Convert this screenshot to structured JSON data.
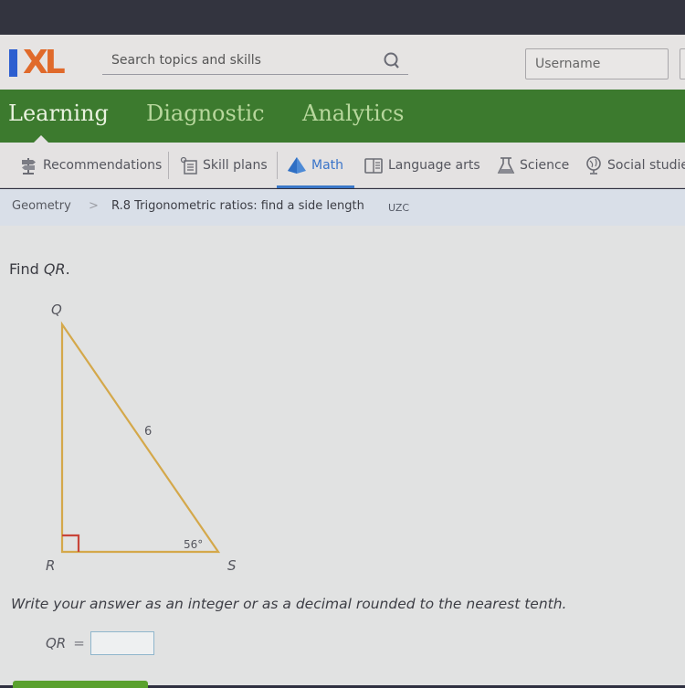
{
  "header": {
    "logo": {
      "i": "I",
      "xl": "XL"
    },
    "search": {
      "placeholder": "Search topics and skills",
      "value": ""
    },
    "username": {
      "placeholder": "Username",
      "value": ""
    }
  },
  "main_nav": {
    "tabs": [
      {
        "label": "Learning",
        "active": true
      },
      {
        "label": "Diagnostic",
        "active": false
      },
      {
        "label": "Analytics",
        "active": false
      }
    ]
  },
  "sub_nav": {
    "items": [
      {
        "label": "Recommendations",
        "icon": "signpost-icon"
      },
      {
        "label": "Skill plans",
        "icon": "skill-plan-icon"
      },
      {
        "label": "Math",
        "icon": "pyramid-icon",
        "active": true
      },
      {
        "label": "Language arts",
        "icon": "book-icon"
      },
      {
        "label": "Science",
        "icon": "flask-icon"
      },
      {
        "label": "Social studies",
        "icon": "globe-icon"
      }
    ]
  },
  "breadcrumb": {
    "subject": "Geometry",
    "separator": ">",
    "skill": "R.8 Trigonometric ratios: find a side length",
    "code": "UZC"
  },
  "problem": {
    "prompt_prefix": "Find ",
    "prompt_var": "QR",
    "prompt_suffix": ".",
    "diagram": {
      "vertices": {
        "top": "Q",
        "right_angle": "R",
        "acute": "S"
      },
      "hypotenuse_label": "6",
      "angle_label": "56°"
    },
    "instructions": "Write your answer as an integer or as a decimal rounded to the nearest tenth.",
    "answer_label": "QR",
    "answer_eq": "=",
    "answer_value": ""
  },
  "colors": {
    "brand_green": "#3c7a2e",
    "logo_blue": "#2d5fd0",
    "logo_orange": "#e06a2b",
    "triangle_stroke": "#d4a84a",
    "right_angle_mark": "#c8453a",
    "active_blue": "#3a74c9"
  }
}
